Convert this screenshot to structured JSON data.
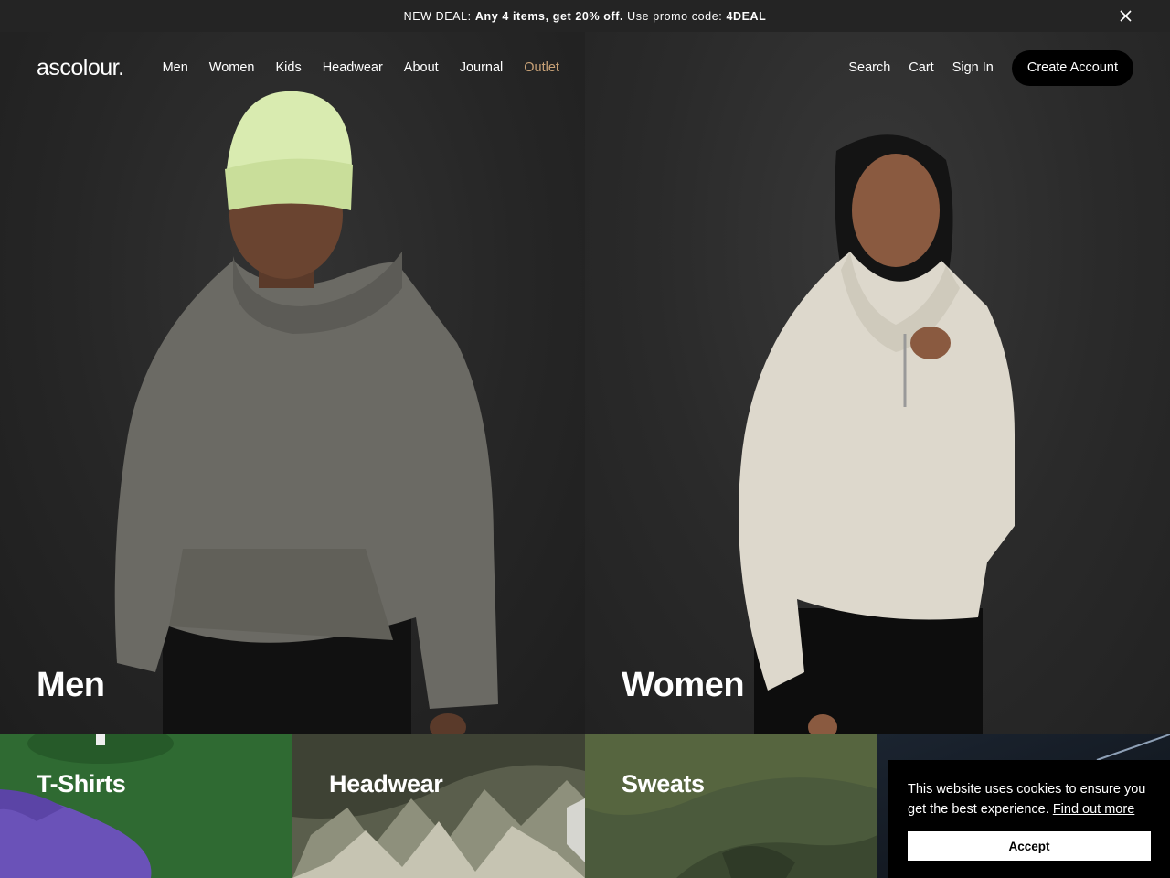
{
  "promo": {
    "prefix": "NEW DEAL: ",
    "bold_offer": "Any 4 items, get 20% off.",
    "middle": " Use promo code: ",
    "code": "4DEAL"
  },
  "header": {
    "logo": "ascolour.",
    "nav": [
      "Men",
      "Women",
      "Kids",
      "Headwear",
      "About",
      "Journal",
      "Outlet"
    ],
    "search": "Search",
    "cart": "Cart",
    "sign_in": "Sign In",
    "create_account": "Create Account"
  },
  "hero": {
    "men_title": "Men",
    "women_title": "Women"
  },
  "tiles": [
    "T-Shirts",
    "Headwear",
    "Sweats"
  ],
  "cookie": {
    "message": "This website uses cookies to ensure you get the best experience. ",
    "link": "Find out more",
    "accept": "Accept"
  },
  "colors": {
    "outlet_accent": "#c9a277",
    "promo_bg": "#242424",
    "tshirt_green": "#2f6a32",
    "sweats_olive": "#4b5a3c"
  }
}
